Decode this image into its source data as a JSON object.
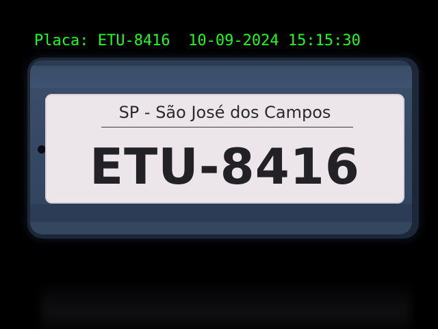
{
  "overlay": {
    "text": "Placa: ETU-8416  10-09-2024 15:15:30",
    "color": "#19ff19"
  },
  "plate": {
    "header": "SP - São José dos Campos",
    "number": "ETU-8416"
  }
}
